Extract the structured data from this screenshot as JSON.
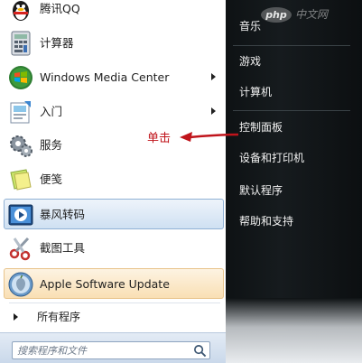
{
  "programs": [
    {
      "label": "腾讯QQ",
      "icon": "qq-penguin-icon"
    },
    {
      "label": "计算器",
      "icon": "calculator-icon"
    },
    {
      "label": "Windows Media Center",
      "icon": "windows-media-center-icon",
      "has_submenu": true
    },
    {
      "label": "入门",
      "icon": "getting-started-icon",
      "has_submenu": true
    },
    {
      "label": "服务",
      "icon": "gears-icon"
    },
    {
      "label": "便笺",
      "icon": "sticky-notes-icon"
    },
    {
      "label": "暴风转码",
      "icon": "video-converter-icon",
      "highlighted": true
    },
    {
      "label": "截图工具",
      "icon": "scissors-icon"
    },
    {
      "label": "Apple Software Update",
      "icon": "apple-update-icon",
      "highlighted": true
    }
  ],
  "all_programs": "所有程序",
  "search": {
    "placeholder": "搜索程序和文件"
  },
  "right_panel": {
    "items": [
      "音乐",
      "游戏",
      "计算机",
      "控制面板",
      "设备和打印机",
      "默认程序",
      "帮助和支持"
    ]
  },
  "annotation": {
    "label": "单击",
    "color": "#c0141b"
  },
  "watermark": {
    "logo": "php",
    "text": "中文网"
  },
  "colors": {
    "right_panel_bg": "#11161a",
    "highlight_blue": "#cfe0f2",
    "highlight_orange": "#f9dfb4"
  }
}
